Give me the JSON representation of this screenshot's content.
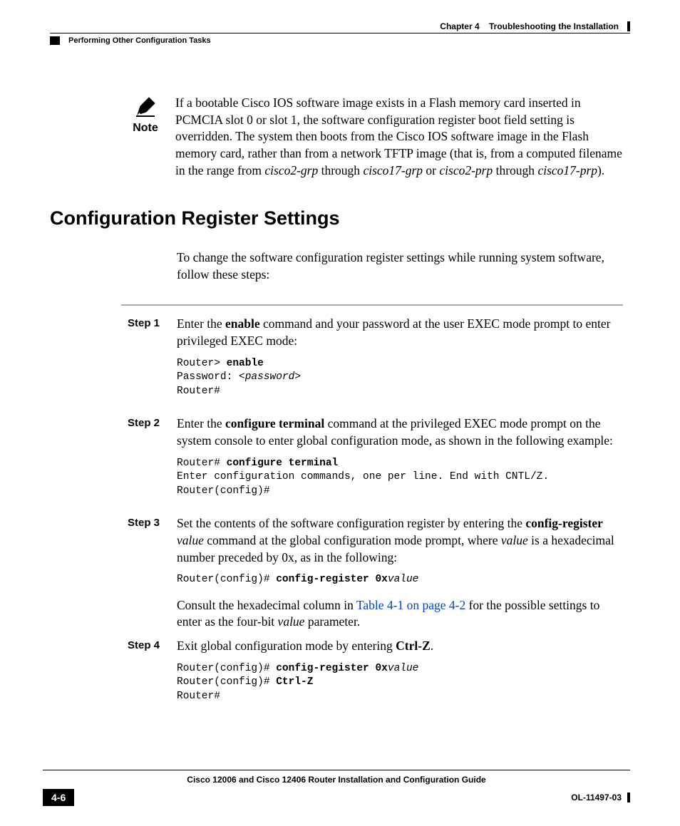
{
  "header": {
    "chapter": "Chapter 4",
    "chapter_title": "Troubleshooting the Installation",
    "section": "Performing Other Configuration Tasks"
  },
  "note": {
    "label": "Note",
    "seg1": "If a bootable Cisco IOS software image exists in a Flash memory card inserted in PCMCIA slot 0 or slot 1, the software configuration register boot field setting is overridden. The system then boots from the Cisco IOS software image in the Flash memory card, rather than from a network TFTP image (that is, from a computed filename in the range from ",
    "it1": "cisco2-grp",
    "seg2": " through ",
    "it2": "cisco17-grp",
    "seg3": " or ",
    "it3": "cisco2-prp",
    "seg4": " through ",
    "it4": "cisco17-prp",
    "seg5": ")."
  },
  "subheading": "Configuration Register Settings",
  "intro": "To change the software configuration register settings while running system software, follow these steps:",
  "steps": {
    "s1": {
      "label": "Step 1",
      "t1": "Enter the ",
      "b1": "enable",
      "t2": " command and your password at the user EXEC mode prompt to enter privileged EXEC mode:",
      "code_l1a": "Router> ",
      "code_l1b": "enable",
      "code_l2a": "Password: <",
      "code_l2b": "password",
      "code_l2c": ">",
      "code_l3": "Router#"
    },
    "s2": {
      "label": "Step 2",
      "t1": "Enter the ",
      "b1": "configure terminal",
      "t2": " command at the privileged EXEC mode prompt on the system console to enter global configuration mode, as shown in the following example:",
      "code_l1a": "Router# ",
      "code_l1b": "configure terminal",
      "code_l2": "Enter configuration commands, one per line. End with CNTL/Z.",
      "code_l3": "Router(config)#"
    },
    "s3": {
      "label": "Step 3",
      "t1": "Set the contents of the software configuration register by entering the ",
      "b1": "config-register",
      "t2": " ",
      "i1": "value",
      "t3": " command at the global configuration mode prompt, where ",
      "i2": "value",
      "t4": " is a hexadecimal number preceded by 0x, as in the following:",
      "code_l1a": "Router(config)# ",
      "code_l1b": "config-register 0x",
      "code_l1c": "value",
      "post_t1": "Consult the hexadecimal column in ",
      "post_link": "Table 4-1 on page 4-2",
      "post_t2": " for the possible settings to enter as the four-bit ",
      "post_i1": "value",
      "post_t3": " parameter."
    },
    "s4": {
      "label": "Step 4",
      "t1": "Exit global configuration mode by entering ",
      "b1": "Ctrl-Z",
      "t2": ".",
      "code_l1a": "Router(config)# ",
      "code_l1b": "config-register 0x",
      "code_l1c": "value",
      "code_l2a": "Router(config)# ",
      "code_l2b": "Ctrl-Z",
      "code_l3": "Router#"
    }
  },
  "footer": {
    "book_title": "Cisco 12006 and Cisco 12406 Router Installation and Configuration Guide",
    "page_number": "4-6",
    "doc_id": "OL-11497-03"
  }
}
